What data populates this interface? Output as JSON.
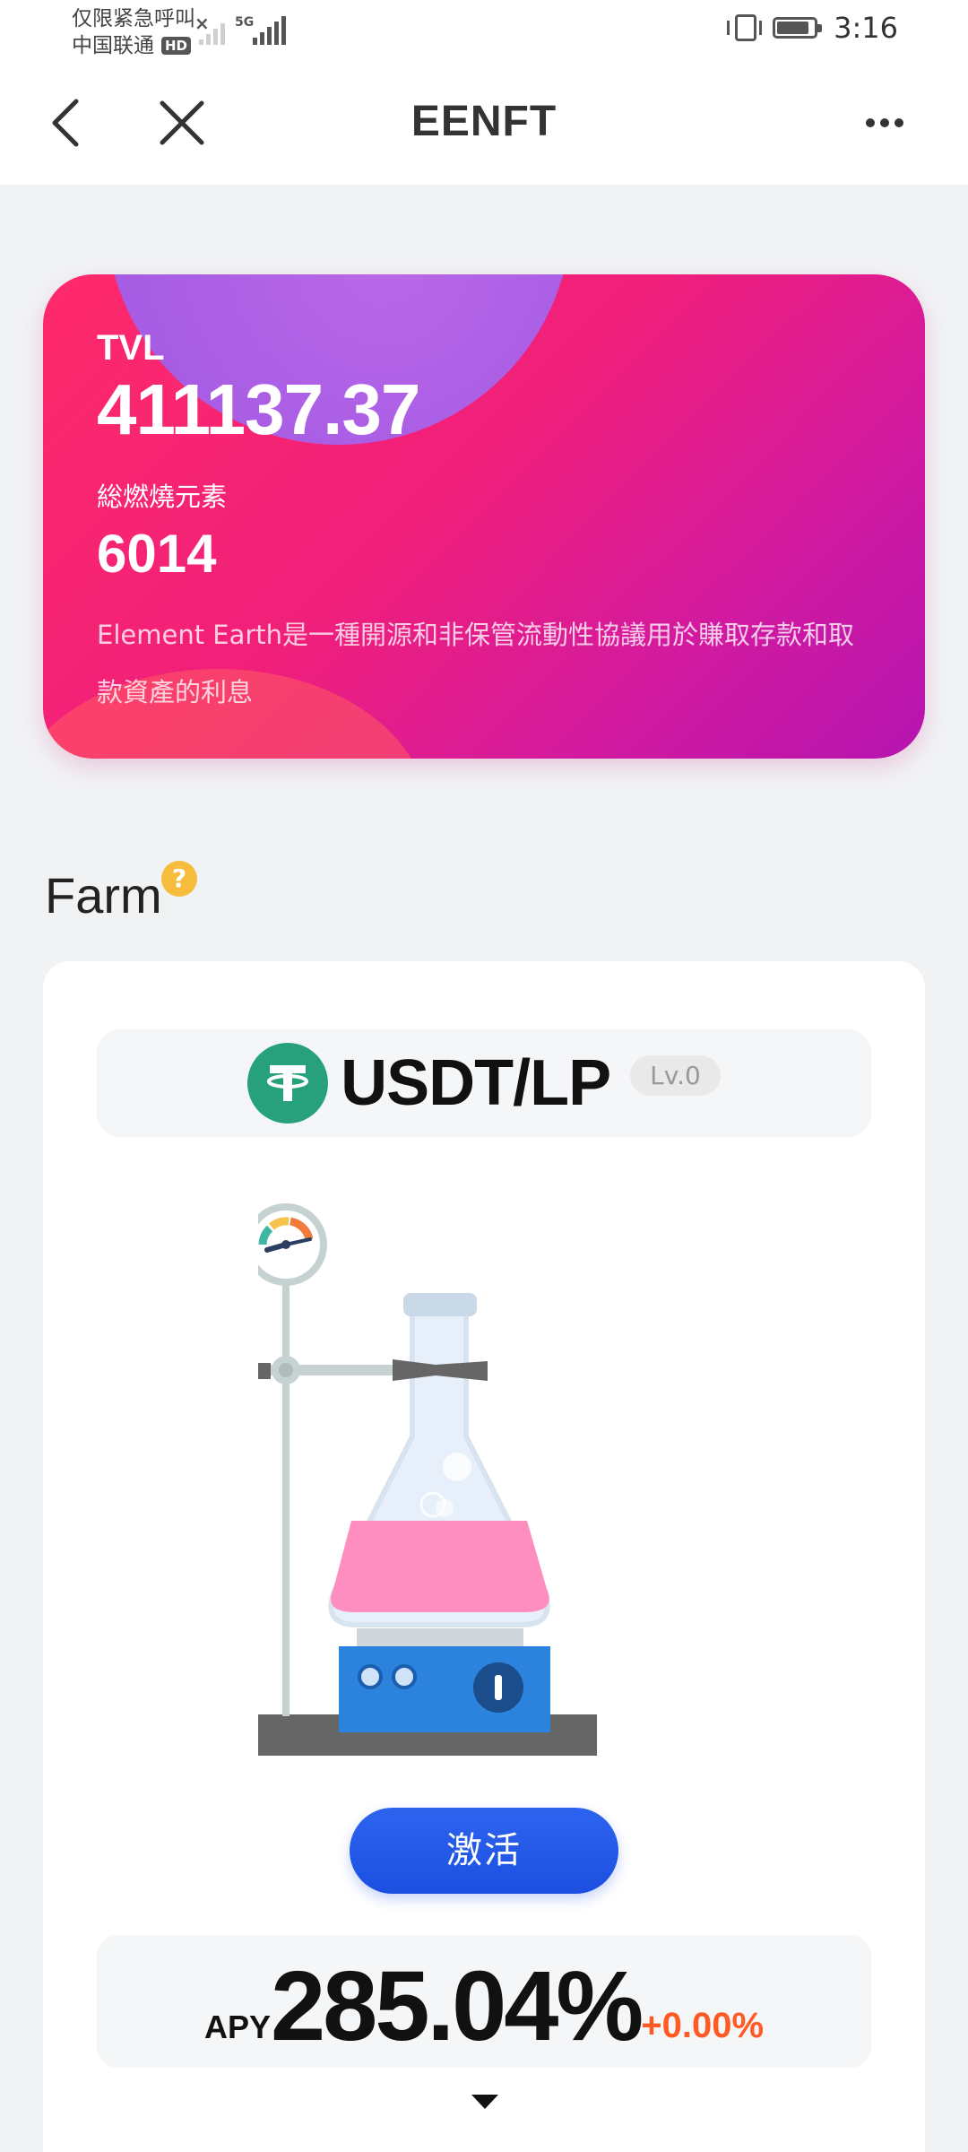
{
  "status_bar": {
    "carrier_line1": "仅限紧急呼叫",
    "carrier_line2": "中国联通",
    "hd": "HD",
    "network": "5G",
    "time": "3:16"
  },
  "nav": {
    "title": "EENFT"
  },
  "hero": {
    "tvl_label": "TVL",
    "tvl_value": "411137.37",
    "burn_label": "総燃燒元素",
    "burn_value": "6014",
    "description": "Element Earth是一種開源和非保管流動性協議用於賺取存款和取款資產的利息"
  },
  "farm": {
    "section_title": "Farm",
    "help_symbol": "?",
    "pair_name": "USDT/LP",
    "level": "Lv.0",
    "activate_label": "激活",
    "apy_label": "APY",
    "apy_value": "285.04%",
    "apy_change": "+0.00%"
  },
  "colors": {
    "accent_blue": "#1f55e6",
    "hero_pink": "#f01f7a",
    "tether_green": "#26a17b",
    "change_orange": "#ff5a24",
    "help_yellow": "#f6bc3c"
  },
  "icons": [
    "back-arrow-icon",
    "close-icon",
    "more-icon",
    "help-icon",
    "tether-icon",
    "flask-illustration",
    "caret-down-icon"
  ]
}
